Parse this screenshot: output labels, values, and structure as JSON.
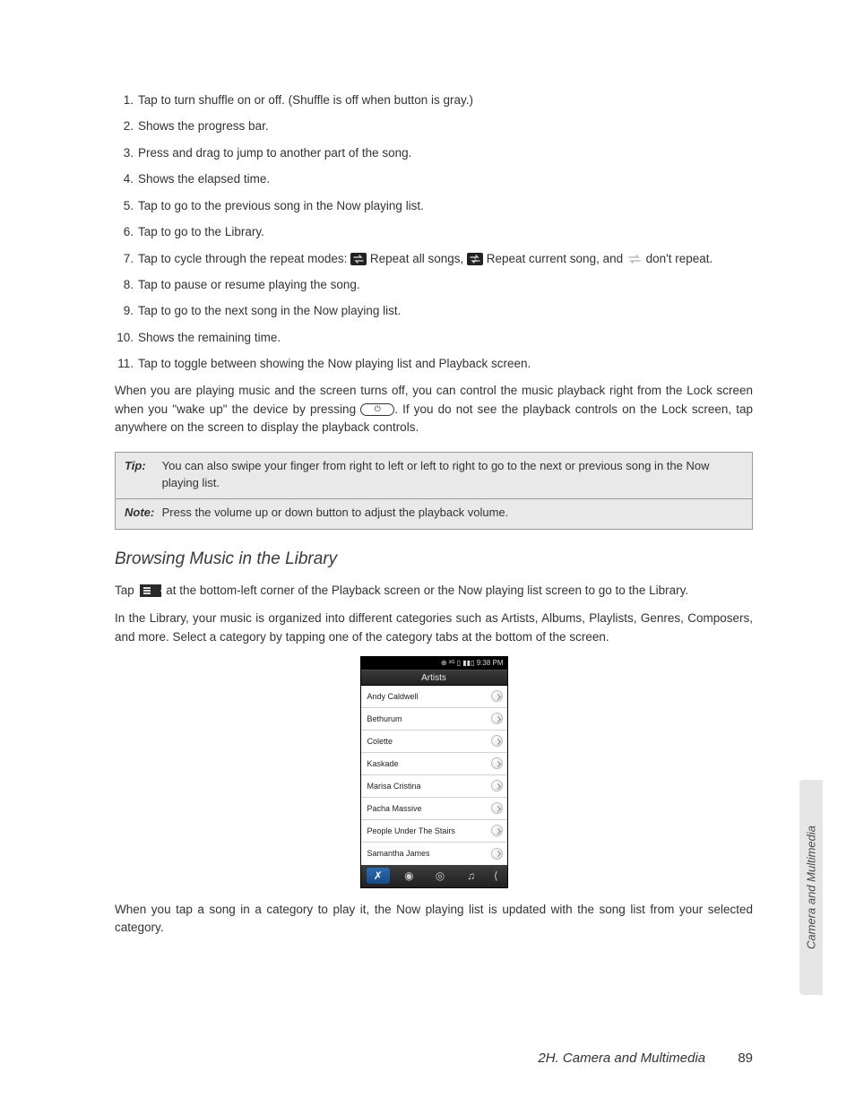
{
  "list": {
    "i1": "Tap to turn shuffle on or off. (Shuffle is off when button is gray.)",
    "i2": "Shows the progress bar.",
    "i3": "Press and drag to jump to another part of the song.",
    "i4": "Shows the elapsed time.",
    "i5": "Tap to go to the previous song in the Now playing list.",
    "i6": "Tap to go to the Library.",
    "i7a": "Tap to cycle through the repeat modes: ",
    "i7b": " Repeat all songs, ",
    "i7c": " Repeat current song, and ",
    "i7d": " don't repeat.",
    "i8": "Tap to pause or resume playing the song.",
    "i9": "Tap to go to the next song in the Now playing list.",
    "i10": "Shows the remaining time.",
    "i11": "Tap to toggle between showing the Now playing list and Playback screen."
  },
  "para1a": "When you are playing music and the screen turns off, you can control the music playback right from the Lock screen when you \"wake up\" the device by pressing ",
  "para1b": ". If you do not see the playback controls on the Lock screen, tap anywhere on the screen to display the playback controls.",
  "tip": {
    "label": "Tip:",
    "text": "You can also swipe your finger from right to left or left to right to go to the next or previous song in the Now playing list."
  },
  "note": {
    "label": "Note:",
    "text": "Press the volume up or down button to adjust the playback volume."
  },
  "heading": "Browsing Music in the Library",
  "para2a": "Tap ",
  "para2b": " at the bottom-left corner of the Playback screen or the Now playing list screen to go to the Library.",
  "para3": "In the Library, your music is organized into different categories such as Artists, Albums, Playlists, Genres, Composers, and more. Select a category by tapping one of the category tabs at the bottom of the screen.",
  "phone": {
    "status": "⊕ ³ᴳ ▯ ▮▮▯ 9:38 PM",
    "title": "Artists",
    "rows": {
      "r0": "Andy Caldwell",
      "r1": "Bethurum",
      "r2": "Colette",
      "r3": "Kaskade",
      "r4": "Marisa Cristina",
      "r5": "Pacha Massive",
      "r6": "People Under The Stairs",
      "r7": "Samantha James"
    }
  },
  "para4": "When you tap a song in a category to play it, the Now playing list is updated with the song list from your selected category.",
  "sidetab": "Camera and Multimedia",
  "footer": {
    "section": "2H. Camera and Multimedia",
    "page": "89"
  }
}
